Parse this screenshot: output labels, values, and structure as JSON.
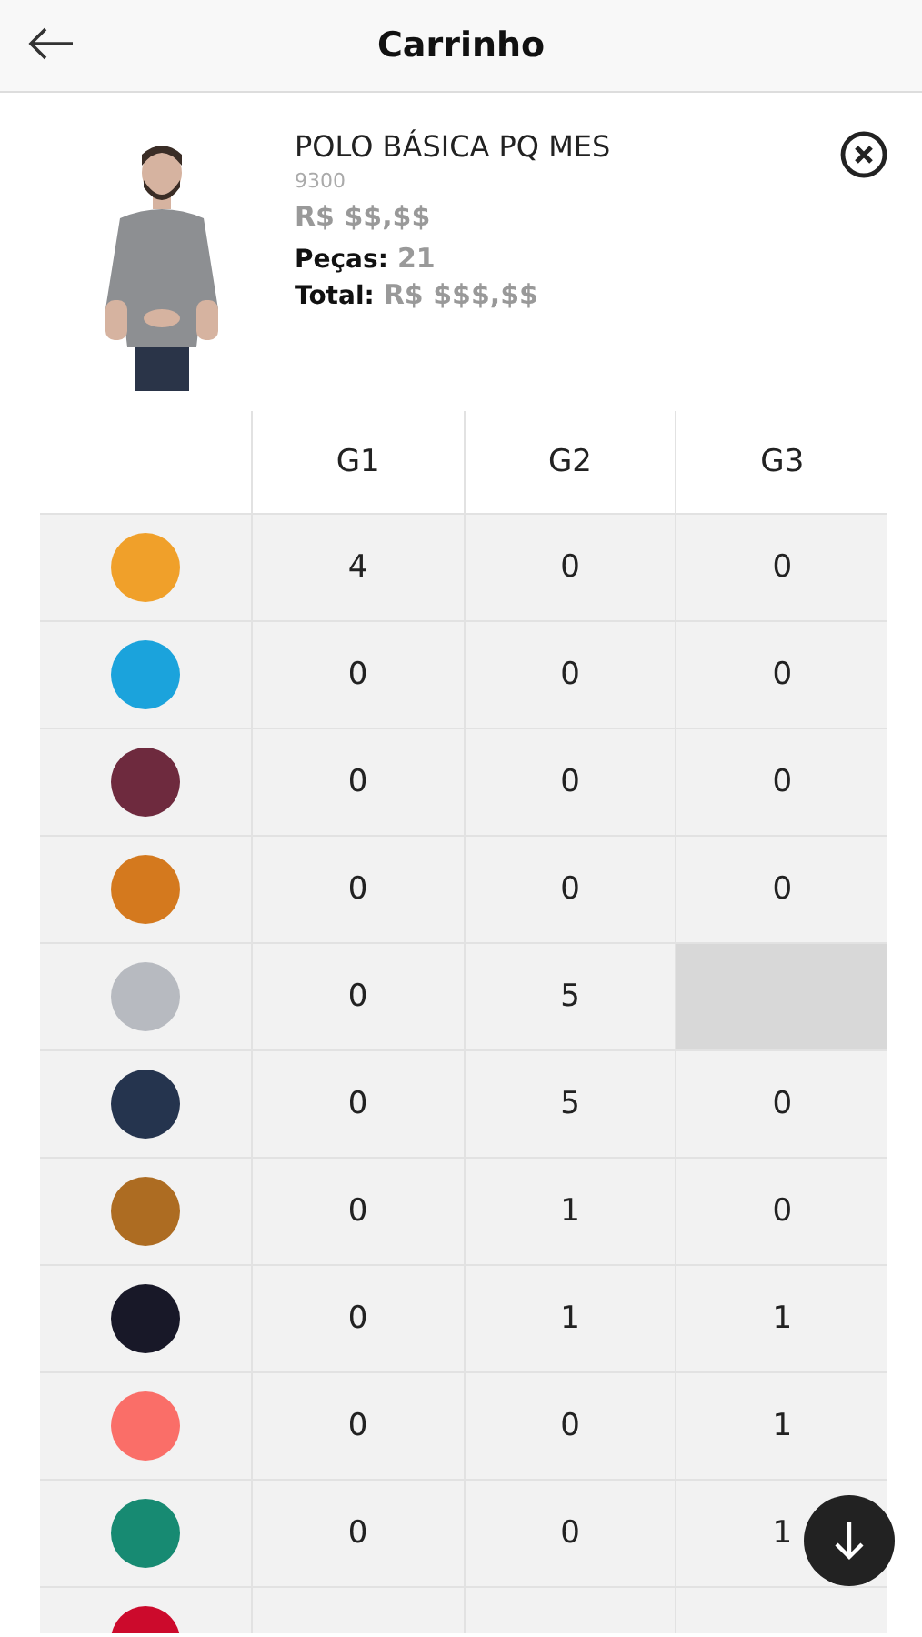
{
  "header": {
    "title": "Carrinho"
  },
  "product": {
    "name": "POLO BÁSICA PQ MES",
    "code": "9300",
    "price": "R$ $$,$$",
    "pieces_label": "Peças:",
    "pieces": "21",
    "total_label": "Total:",
    "total": "R$ $$$,$$"
  },
  "grid": {
    "columns": [
      "G1",
      "G2",
      "G3"
    ],
    "rows": [
      {
        "color": "#f0a02a",
        "cells": [
          {
            "value": "4",
            "disabled": false
          },
          {
            "value": "0",
            "disabled": false
          },
          {
            "value": "0",
            "disabled": false
          }
        ]
      },
      {
        "color": "#1ba3dc",
        "cells": [
          {
            "value": "0",
            "disabled": false
          },
          {
            "value": "0",
            "disabled": false
          },
          {
            "value": "0",
            "disabled": false
          }
        ]
      },
      {
        "color": "#6e2a3e",
        "cells": [
          {
            "value": "0",
            "disabled": false
          },
          {
            "value": "0",
            "disabled": false
          },
          {
            "value": "0",
            "disabled": false
          }
        ]
      },
      {
        "color": "#d4791e",
        "cells": [
          {
            "value": "0",
            "disabled": false
          },
          {
            "value": "0",
            "disabled": false
          },
          {
            "value": "0",
            "disabled": false
          }
        ]
      },
      {
        "color": "#b7bac0",
        "cells": [
          {
            "value": "0",
            "disabled": false
          },
          {
            "value": "5",
            "disabled": false
          },
          {
            "disabled": true
          }
        ]
      },
      {
        "color": "#25344e",
        "cells": [
          {
            "value": "0",
            "disabled": false
          },
          {
            "value": "5",
            "disabled": false
          },
          {
            "value": "0",
            "disabled": false
          }
        ]
      },
      {
        "color": "#ad6c22",
        "cells": [
          {
            "value": "0",
            "disabled": false
          },
          {
            "value": "1",
            "disabled": false
          },
          {
            "value": "0",
            "disabled": false
          }
        ]
      },
      {
        "color": "#181828",
        "cells": [
          {
            "value": "0",
            "disabled": false
          },
          {
            "value": "1",
            "disabled": false
          },
          {
            "value": "1",
            "disabled": false
          }
        ]
      },
      {
        "color": "#fa6e68",
        "cells": [
          {
            "value": "0",
            "disabled": false
          },
          {
            "value": "0",
            "disabled": false
          },
          {
            "value": "1",
            "disabled": false
          }
        ]
      },
      {
        "color": "#178a72",
        "cells": [
          {
            "value": "0",
            "disabled": false
          },
          {
            "value": "0",
            "disabled": false
          },
          {
            "value": "1",
            "disabled": false
          }
        ]
      },
      {
        "color": "#cc0a2c"
      }
    ]
  }
}
